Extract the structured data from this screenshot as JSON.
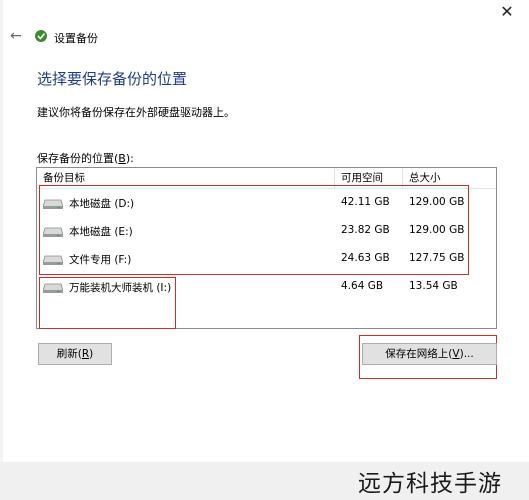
{
  "window": {
    "title": "设置备份",
    "back_icon": "←",
    "close_icon": "✕"
  },
  "main": {
    "heading": "选择要保存备份的位置",
    "description": "建议你将备份保存在外部硬盘驱动器上。",
    "list_label": "保存备份的位置(",
    "list_label_key": "B",
    "list_label_end": "):"
  },
  "table": {
    "headers": [
      "备份目标",
      "可用空间",
      "总大小"
    ],
    "rows": [
      {
        "name": "本地磁盘 (D:)",
        "free": "42.11 GB",
        "total": "129.00 GB"
      },
      {
        "name": "本地磁盘 (E:)",
        "free": "23.82 GB",
        "total": "129.00 GB"
      },
      {
        "name": "文件专用 (F:)",
        "free": "24.63 GB",
        "total": "127.75 GB"
      },
      {
        "name": "万能装机大师装机 (I:)",
        "free": "4.64 GB",
        "total": "13.54 GB"
      }
    ]
  },
  "buttons": {
    "refresh_pre": "刷新(",
    "refresh_key": "R",
    "refresh_post": ")",
    "network_pre": "保存在网络上(",
    "network_key": "V",
    "network_post": ")..."
  },
  "watermark": "远方科技手游",
  "colors": {
    "heading": "#1f3d8c",
    "highlight_box": "#cf2c2c"
  }
}
